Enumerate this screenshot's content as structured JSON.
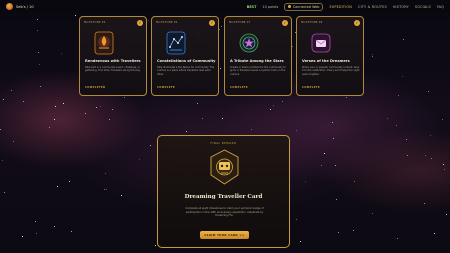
{
  "topbar": {
    "brand": "Seb's / 10",
    "level_pill": "BEST",
    "level_count": "10 points",
    "link_pill": "Connected Web",
    "nav": [
      "EXPEDITION",
      "CITY & ROUTES",
      "HISTORY",
      "SOCIALS",
      "FAQ"
    ],
    "active_index": 0
  },
  "cards": [
    {
      "tag": "MILESTONE 26",
      "title": "Rendezvous with Travellers",
      "desc": "Take part in a community event, challenge, or gathering. Find other Travellers along the way.",
      "status": "COMPLETED",
      "emblem": "campfire-emblem",
      "color": "#e07b2a"
    },
    {
      "tag": "MILESTONE 06",
      "title": "Constellations of Community",
      "desc": "Help illuminate a the Nexus for community. The cosmos is a place where travellers lead each other.",
      "status": "COMPLETE",
      "emblem": "constellation-emblem",
      "color": "#3a7bd5"
    },
    {
      "tag": "MILESTONE 07",
      "title": "A Tribute Among the Stars",
      "desc": "Create or share a tribute for the community to grow. A Traveller leaves a symbol mark on the cosmos.",
      "status": "COMPLETE",
      "emblem": "star-wreath-emblem",
      "color": "#4aa85a"
    },
    {
      "tag": "MILESTONE 08",
      "title": "Verses of the Dreamers",
      "desc": "Share your or popular community content. Give it to the celebration. Every word helps the night seem brighter.",
      "status": "COMPLETE",
      "emblem": "verse-emblem",
      "color": "#b34fa8"
    }
  ],
  "reward": {
    "tag": "FINAL REWARD",
    "title": "Dreaming Traveller Card",
    "desc": "Complete all eight milestones to claim your symbolic badge of participation in the 10th anniversary expedition. Celebrate by Dreaming Fox.",
    "button": "CLAIM YOUR CARD >>"
  }
}
